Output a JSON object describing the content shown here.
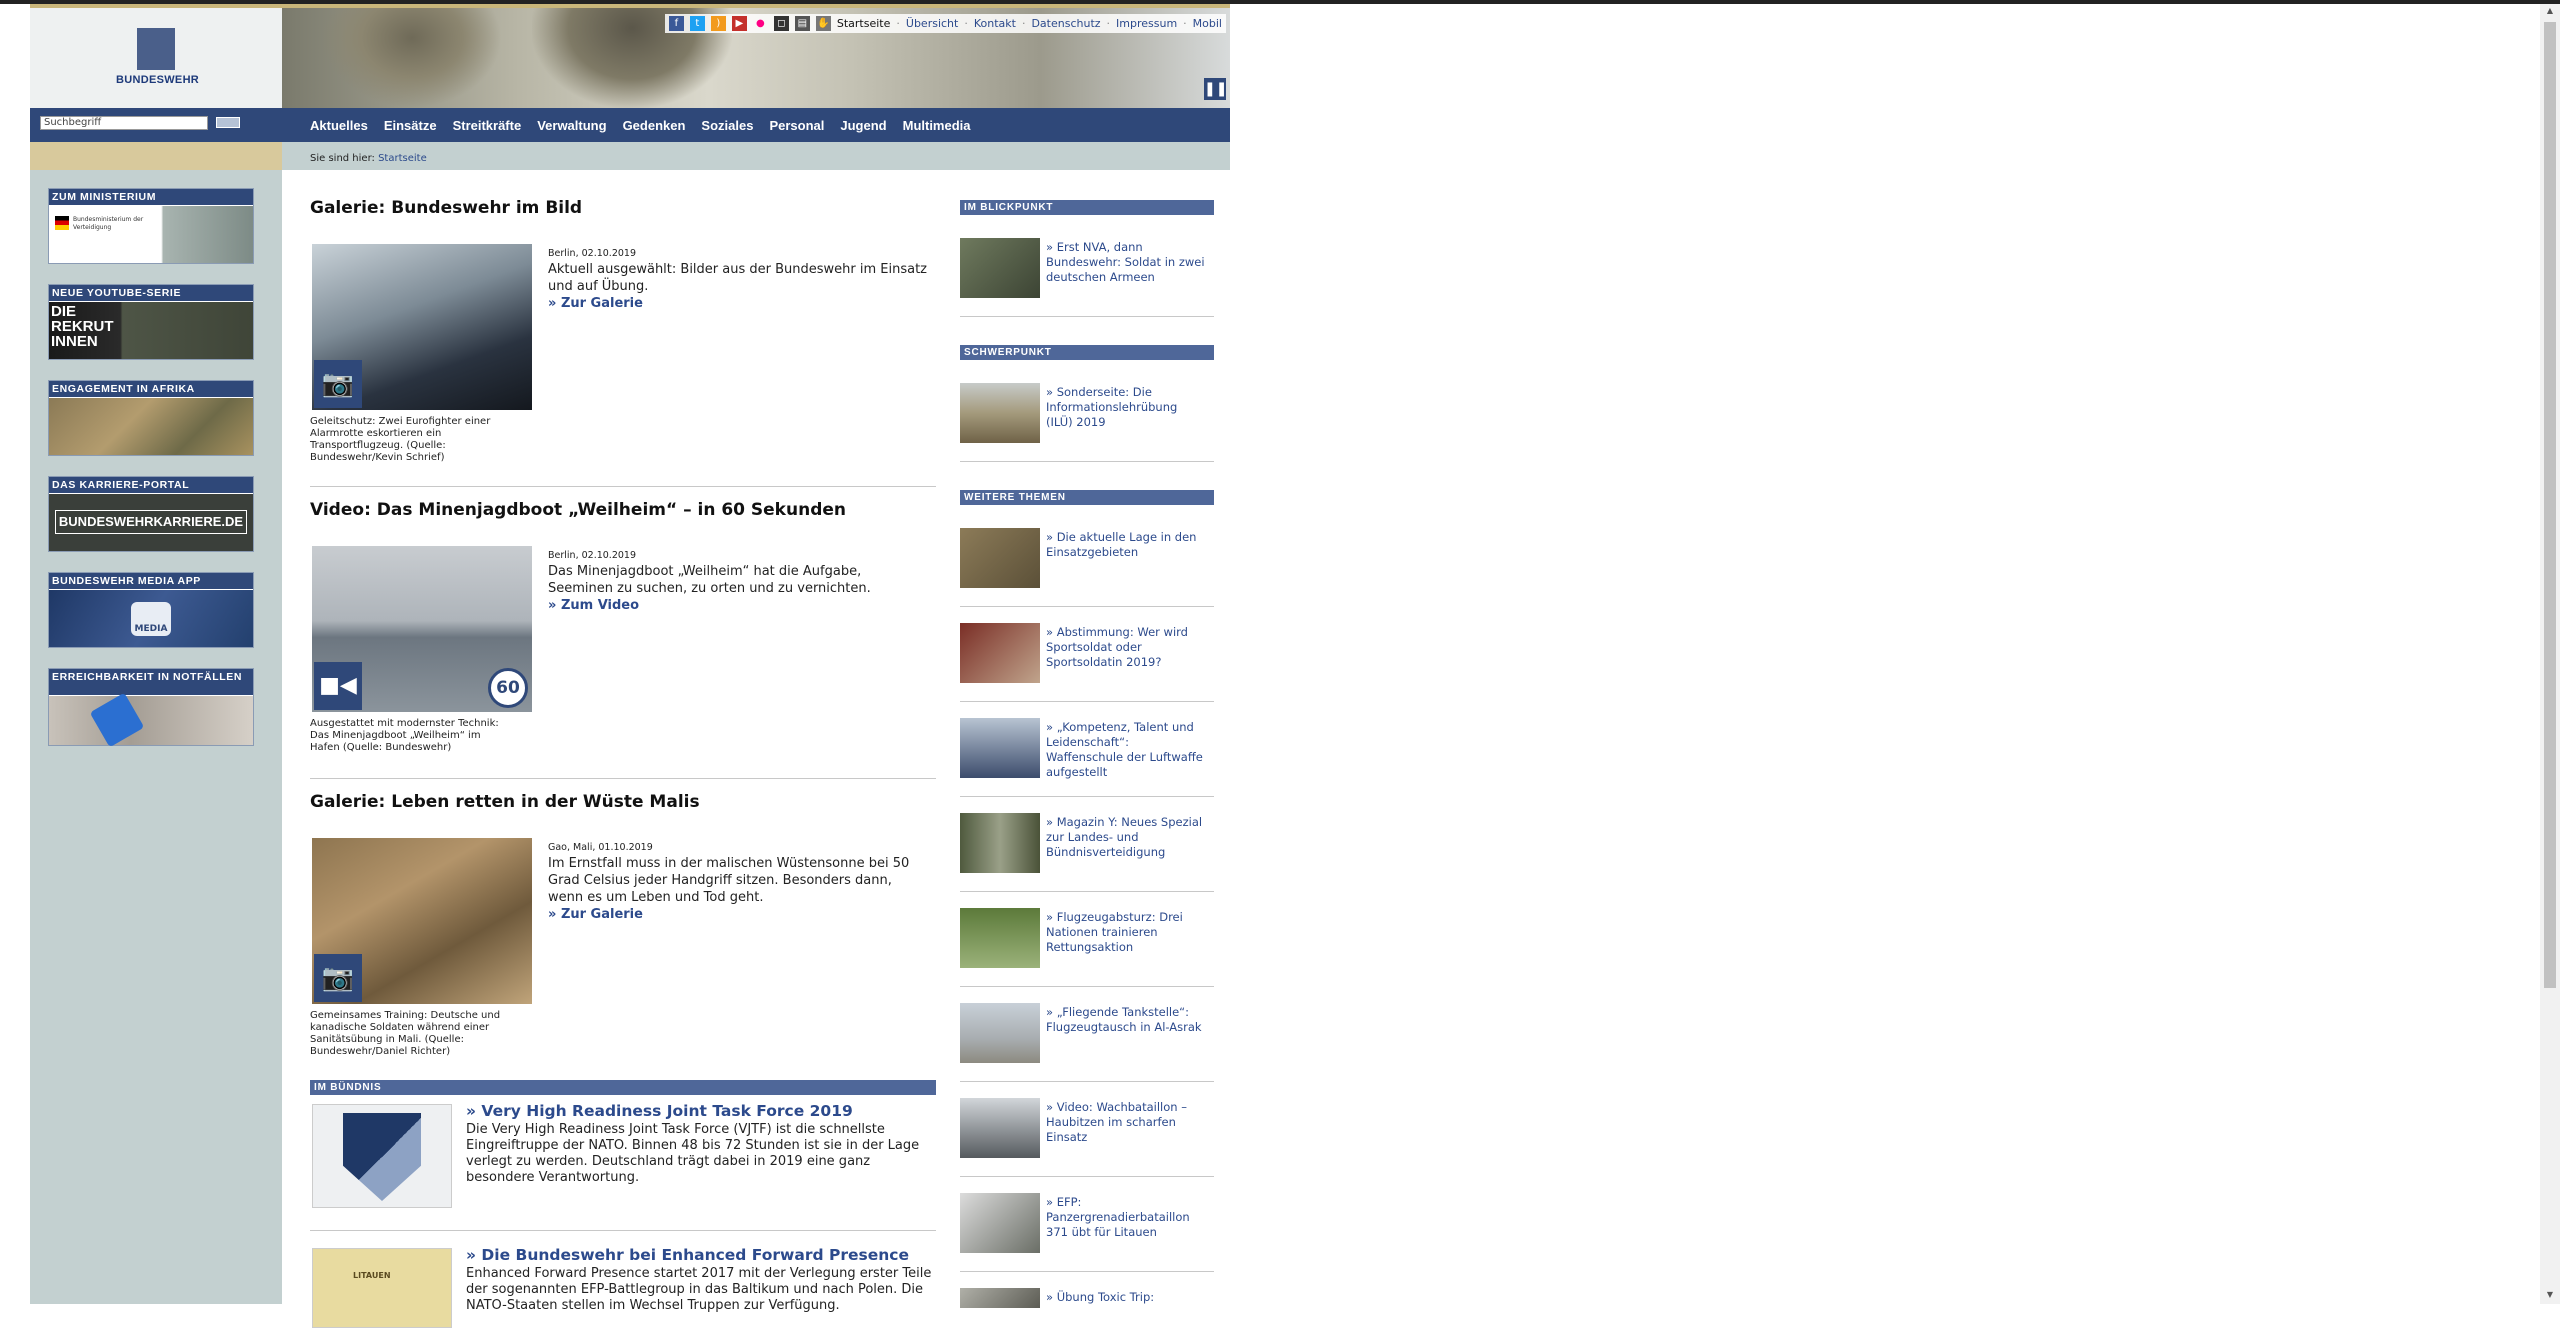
{
  "brand": {
    "name": "BUNDESWEHR"
  },
  "topnav": {
    "links": [
      "Startseite",
      "Übersicht",
      "Kontakt",
      "Datenschutz",
      "Impressum",
      "Mobil"
    ]
  },
  "search": {
    "placeholder": "Suchbegriff"
  },
  "menu": [
    "Aktuelles",
    "Einsätze",
    "Streitkräfte",
    "Verwaltung",
    "Gedenken",
    "Soziales",
    "Personal",
    "Jugend",
    "Multimedia"
  ],
  "breadcrumb": {
    "prefix": "Sie sind hier:",
    "current": "Startseite"
  },
  "left_promos": [
    {
      "header": "ZUM MINISTERIUM",
      "sub": "Bundesministerium der Verteidigung"
    },
    {
      "header": "NEUE YOUTUBE-SERIE",
      "sub": "DIE REKRUT INNEN"
    },
    {
      "header": "ENGAGEMENT IN AFRIKA",
      "sub": ""
    },
    {
      "header": "DAS KARRIERE-PORTAL",
      "sub": "BUNDESWEHRKARRIERE.DE"
    },
    {
      "header": "BUNDESWEHR MEDIA APP",
      "sub": "MEDIA"
    },
    {
      "header": "ERREICHBARKEIT IN NOTFÄLLEN",
      "sub": ""
    }
  ],
  "articles": [
    {
      "title": "Galerie: Bundeswehr im Bild",
      "date": "Berlin, 02.10.2019",
      "teaser": "Aktuell ausgewählt: Bilder aus der Bundeswehr im Einsatz und auf Übung.",
      "more": "Zur Galerie",
      "caption": "Geleitschutz: Zwei Eurofighter einer Alarmrotte eskortieren ein Transportflugzeug. (Quelle: Bundeswehr/Kevin Schrief)"
    },
    {
      "title": "Video: Das Minenjagdboot „Weilheim“ – in 60 Sekunden",
      "date": "Berlin, 02.10.2019",
      "teaser": "Das Minenjagdboot „Weilheim“ hat die Aufgabe, Seeminen zu suchen, zu orten und zu vernichten.",
      "more": "Zum Video",
      "caption": "Ausgestattet mit modernster Technik: Das Minenjagdboot „Weilheim“ im Hafen (Quelle: Bundeswehr)",
      "badge": "60"
    },
    {
      "title": "Galerie: Leben retten in der Wüste Malis",
      "date": "Gao, Mali, 01.10.2019",
      "teaser": "Im Ernstfall muss in der malischen Wüstensonne bei 50 Grad Celsius jeder Handgriff sitzen. Besonders dann, wenn es um Leben und Tod geht.",
      "more": "Zur Galerie",
      "caption": "Gemeinsames Training: Deutsche und kanadische Soldaten während einer Sanitätsübung in Mali. (Quelle: Bundeswehr/Daniel Richter)"
    }
  ],
  "buendnis": {
    "header": "IM BÜNDNIS",
    "items": [
      {
        "title": "Very High Readiness Joint Task Force 2019",
        "body": "Die Very High Readiness Joint Task Force (VJTF) ist die schnellste Eingreiftruppe der NATO. Binnen 48 bis 72 Stunden ist sie in der Lage verlegt zu werden. Deutschland trägt dabei in 2019 eine ganz besondere Verantwortung."
      },
      {
        "title": "Die Bundeswehr bei Enhanced Forward Presence",
        "body": "Enhanced Forward Presence startet 2017 mit der Verlegung erster Teile der sogenannten EFP-Battlegroup in das Baltikum und nach Polen. Die NATO-Staaten stellen im Wechsel Truppen zur Verfügung.",
        "map_label": "LITAUEN"
      }
    ]
  },
  "sidebar": {
    "blickpunkt": {
      "header": "IM BLICKPUNKT",
      "items": [
        "Erst NVA, dann Bundeswehr: Soldat in zwei deutschen Armeen"
      ]
    },
    "schwerpunkt": {
      "header": "SCHWERPUNKT",
      "items": [
        "Sonderseite: Die Informationslehrübung (ILÜ) 2019"
      ]
    },
    "weitere": {
      "header": "WEITERE THEMEN",
      "items": [
        "Die aktuelle Lage in den Einsatzgebieten",
        "Abstimmung: Wer wird Sportsoldat oder Sportsoldatin 2019?",
        "„Kompetenz, Talent und Leidenschaft“: Waffenschule der Luftwaffe aufgestellt",
        "Magazin Y: Neues Spezial zur Landes- und Bündnisverteidigung",
        "Flugzeugabsturz: Drei Nationen trainieren Rettungsaktion",
        "„Fliegende Tankstelle“: Flugzeugtausch in Al-Asrak",
        "Video: Wachbataillon – Haubitzen im scharfen Einsatz",
        "EFP: Panzergrenadierbataillon 371 übt für Litauen",
        "Übung Toxic Trip:"
      ]
    }
  },
  "colors": {
    "navy": "#2f4879",
    "link": "#2c4a8c",
    "sidebar_bg": "#c3d0d0",
    "gold": "#c9b67a"
  }
}
